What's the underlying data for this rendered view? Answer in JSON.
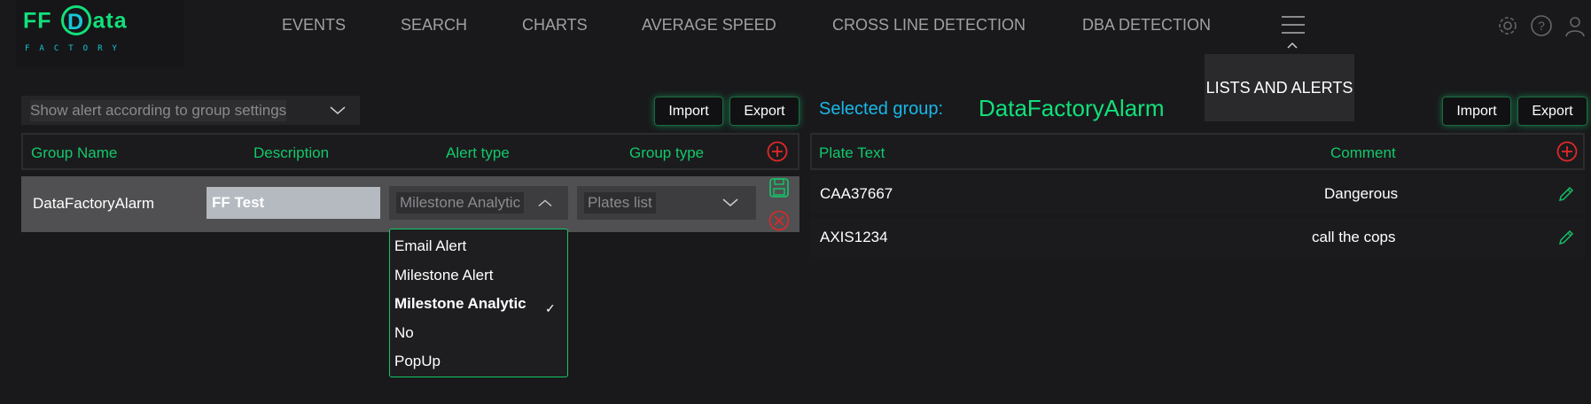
{
  "logo": {
    "ff": "FF",
    "d": "D",
    "ata": "ata",
    "sub": "FACTORY"
  },
  "nav": [
    "EVENTS",
    "SEARCH",
    "CHARTS",
    "AVERAGE SPEED",
    "CROSS LINE DETECTION",
    "DBA DETECTION"
  ],
  "menu_dropdown": {
    "item": "LISTS AND ALERTS"
  },
  "header_icons": [
    "gear-icon",
    "help-icon",
    "user-icon"
  ],
  "left": {
    "filter_select": "Show alert according to group settings",
    "import_label": "Import",
    "export_label": "Export",
    "columns": [
      "Group Name",
      "Description",
      "Alert type",
      "Group type"
    ],
    "row": {
      "group_name": "DataFactoryAlarm",
      "description": "FF Test",
      "alert_type": "Milestone Analytic",
      "group_type": "Plates list"
    },
    "alert_options": [
      "Email Alert",
      "Milestone Alert",
      "Milestone Analytic",
      "No",
      "PopUp"
    ],
    "alert_selected": "Milestone Analytic"
  },
  "right": {
    "selected_label": "Selected group:",
    "selected_group": "DataFactoryAlarm",
    "import_label": "Import",
    "export_label": "Export",
    "columns": [
      "Plate Text",
      "Comment"
    ],
    "rows": [
      {
        "plate": "CAA37667",
        "comment": "Dangerous"
      },
      {
        "plate": "AXIS1234",
        "comment": "call the cops"
      }
    ]
  },
  "colors": {
    "accent": "#12e07a",
    "accent_dim": "#12c86a",
    "blue": "#18b8e8",
    "danger": "#e02828",
    "bg": "#19191b"
  }
}
